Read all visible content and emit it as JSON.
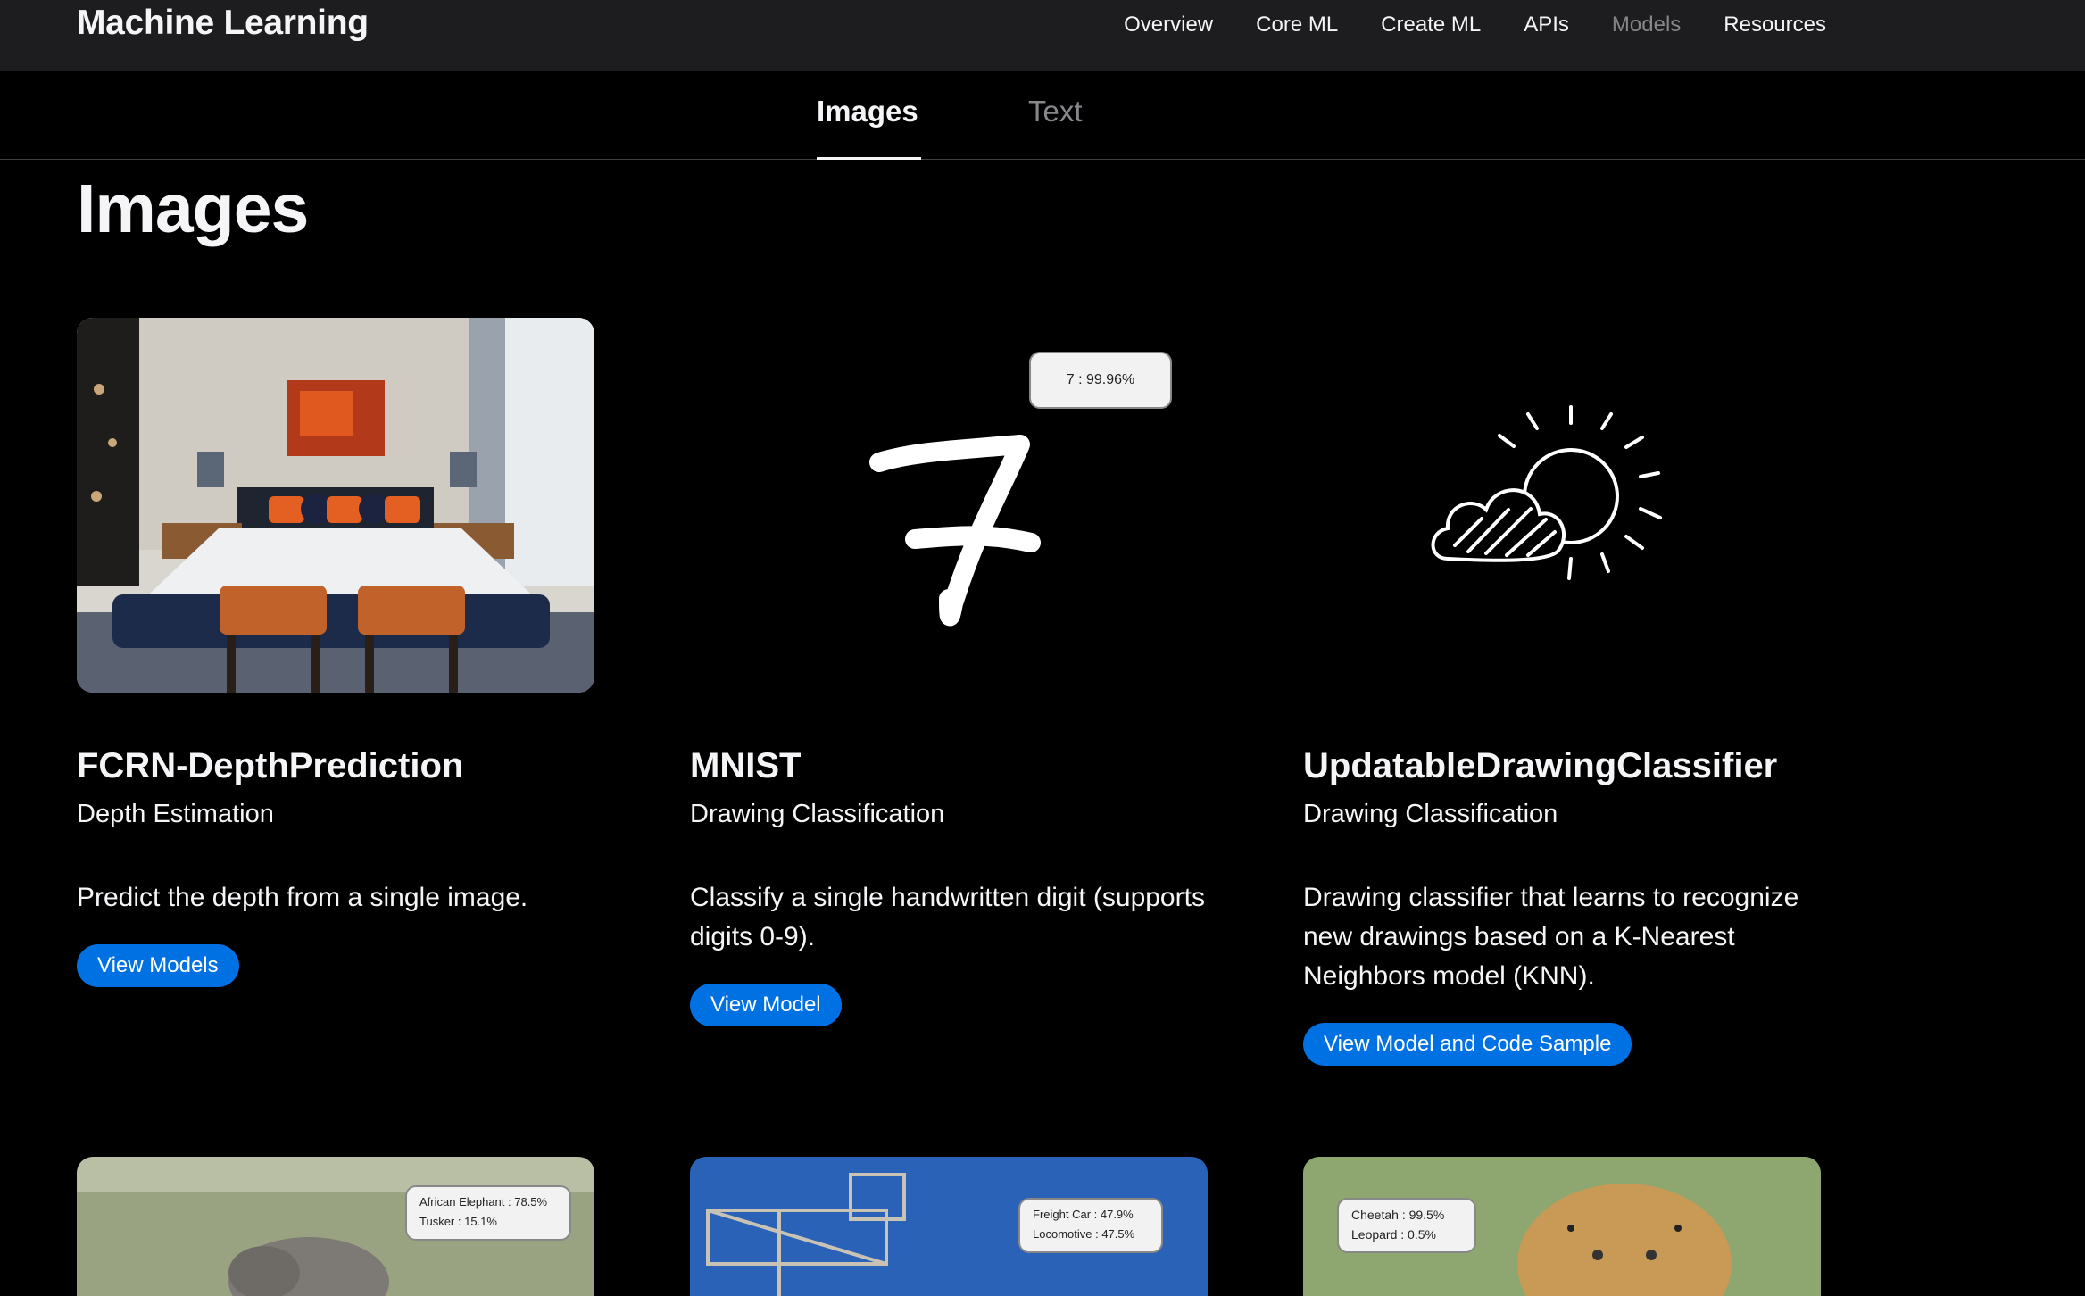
{
  "nav": {
    "brand": "Machine Learning",
    "links": [
      "Overview",
      "Core ML",
      "Create ML",
      "APIs",
      "Models",
      "Resources"
    ],
    "current": "Models"
  },
  "tabs": {
    "active": "Images",
    "inactive": "Text"
  },
  "section_title": "Images",
  "cards": [
    {
      "title": "FCRN-DepthPrediction",
      "category": "Depth Estimation",
      "description": "Predict the depth from a single image.",
      "button": "View Models"
    },
    {
      "title": "MNIST",
      "category": "Drawing Classification",
      "description": "Classify a single handwritten digit (supports digits 0-9).",
      "button": "View Model",
      "prediction": "7 : 99.96%"
    },
    {
      "title": "UpdatableDrawingClassifier",
      "category": "Drawing Classification",
      "description": "Drawing classifier that learns to recognize new drawings based on a K-Nearest Neighbors model (KNN).",
      "button": "View Model and Code Sample"
    }
  ],
  "bottom_row": [
    {
      "line1": "African Elephant : 78.5%",
      "line2": "Tusker : 15.1%"
    },
    {
      "line1": "Freight Car : 47.9%",
      "line2": "Locomotive : 47.5%"
    },
    {
      "line1": "Cheetah : 99.5%",
      "line2": "Leopard : 0.5%"
    }
  ],
  "colors": {
    "accent": "#0071e3",
    "nav_bg": "#1d1d1f",
    "muted": "#86868b"
  }
}
